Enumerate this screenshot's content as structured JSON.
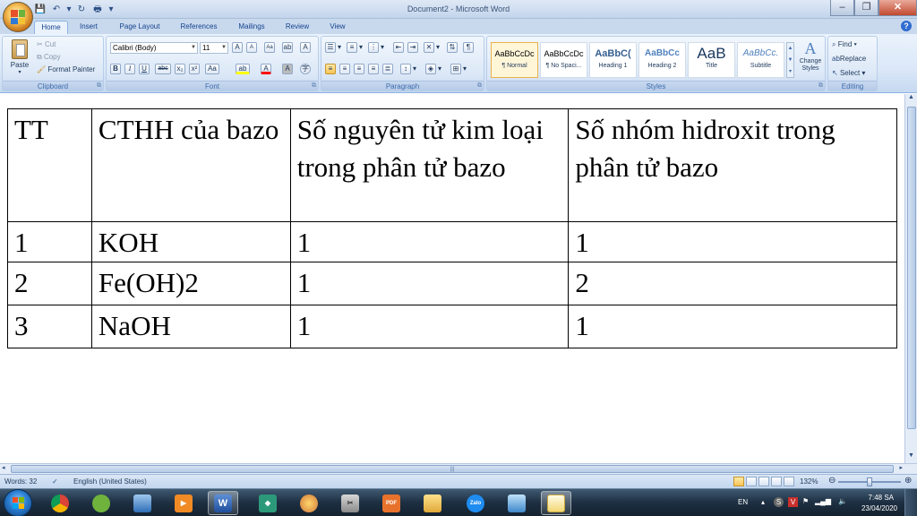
{
  "window": {
    "title": "Document2 - Microsoft Word"
  },
  "qat": {
    "save": "💾",
    "undo": "↶",
    "undo_more": "▾",
    "redo": "↻",
    "print_preview": "🖶",
    "customize": "▾"
  },
  "tabs": [
    "Home",
    "Insert",
    "Page Layout",
    "References",
    "Mailings",
    "Review",
    "View"
  ],
  "ribbon": {
    "clipboard": {
      "label": "Clipboard",
      "paste": "Paste",
      "cut": "Cut",
      "copy": "Copy",
      "format_painter": "Format Painter"
    },
    "font": {
      "label": "Font",
      "font_name": "Calibri (Body)",
      "font_size": "11",
      "grow": "A",
      "shrink": "A",
      "clear": "Aa",
      "bold": "B",
      "italic": "I",
      "underline": "U",
      "strike": "abc",
      "subscript": "x₂",
      "superscript": "x²",
      "change_case": "Aa",
      "highlight": "ab",
      "font_color": "A"
    },
    "paragraph": {
      "label": "Paragraph"
    },
    "styles": {
      "label": "Styles",
      "items": [
        {
          "sample": "AaBbCcDc",
          "name": "¶ Normal"
        },
        {
          "sample": "AaBbCcDc",
          "name": "¶ No Spaci..."
        },
        {
          "sample": "AaBbC(",
          "name": "Heading 1"
        },
        {
          "sample": "AaBbCc",
          "name": "Heading 2"
        },
        {
          "sample": "AaB",
          "name": "Title"
        },
        {
          "sample": "AaBbCc.",
          "name": "Subtitle"
        }
      ],
      "change_styles": "Change Styles"
    },
    "editing": {
      "label": "Editing",
      "find": "Find",
      "replace": "Replace",
      "select": "Select"
    }
  },
  "table": {
    "header": [
      "TT",
      "CTHH của bazo",
      "Số nguyên tử kim loại trong  phân tử bazo",
      "Số nhóm hidroxit trong phân tử bazo"
    ],
    "rows": [
      [
        "1",
        "KOH",
        "1",
        "1"
      ],
      [
        "2",
        "Fe(OH)2",
        "1",
        "2"
      ],
      [
        "3",
        "NaOH",
        "1",
        "1"
      ]
    ]
  },
  "status": {
    "words": "Words: 32",
    "language": "English (United States)",
    "zoom": "132%"
  },
  "taskbar": {
    "tray_lang": "EN",
    "time": "7:48 SA",
    "date": "23/04/2020",
    "apps": [
      {
        "name": "chrome",
        "label": ""
      },
      {
        "name": "app2",
        "label": ""
      },
      {
        "name": "app3",
        "label": ""
      },
      {
        "name": "media",
        "label": ""
      },
      {
        "name": "word",
        "label": "W"
      },
      {
        "name": "app6",
        "label": ""
      },
      {
        "name": "app7",
        "label": ""
      },
      {
        "name": "app8",
        "label": ""
      },
      {
        "name": "pdf",
        "label": "PDF"
      },
      {
        "name": "explorer",
        "label": ""
      },
      {
        "name": "zalo",
        "label": "Zalo"
      },
      {
        "name": "app12",
        "label": ""
      },
      {
        "name": "notepad",
        "label": ""
      }
    ]
  },
  "colors": {
    "ribbon_bg": "#dbe8f8",
    "accent": "#15428b",
    "taskbar": "#1d2f42"
  }
}
